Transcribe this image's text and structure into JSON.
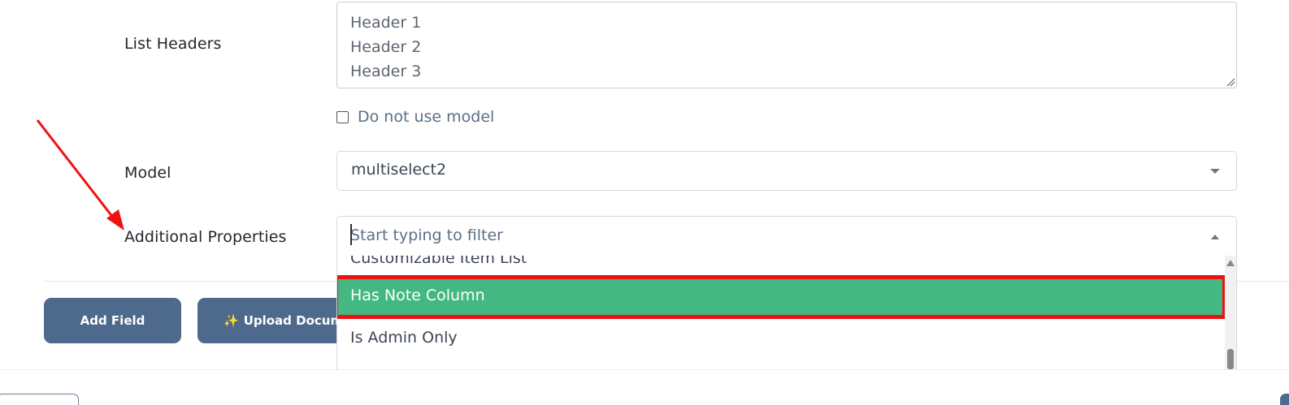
{
  "form": {
    "list_headers": {
      "label": "List Headers",
      "value": "Header 1\nHeader 2\nHeader 3"
    },
    "do_not_use_model": {
      "label": "Do not use model",
      "checked": false
    },
    "model": {
      "label": "Model",
      "value": "multiselect2"
    },
    "additional_properties": {
      "label": "Additional Properties",
      "filter_placeholder": "Start typing to filter",
      "options": [
        {
          "label": "Customizable Item List",
          "state": "partially-visible"
        },
        {
          "label": "Has Note Column",
          "state": "highlighted"
        },
        {
          "label": "Is Admin Only",
          "state": "normal"
        }
      ]
    }
  },
  "actions": {
    "add_field_label": "Add Field",
    "upload_document_label": "Upload Docume"
  },
  "colors": {
    "primary_button": "#4d6a8c",
    "highlight_option": "#43b883",
    "annotation_red": "#ee1111"
  }
}
